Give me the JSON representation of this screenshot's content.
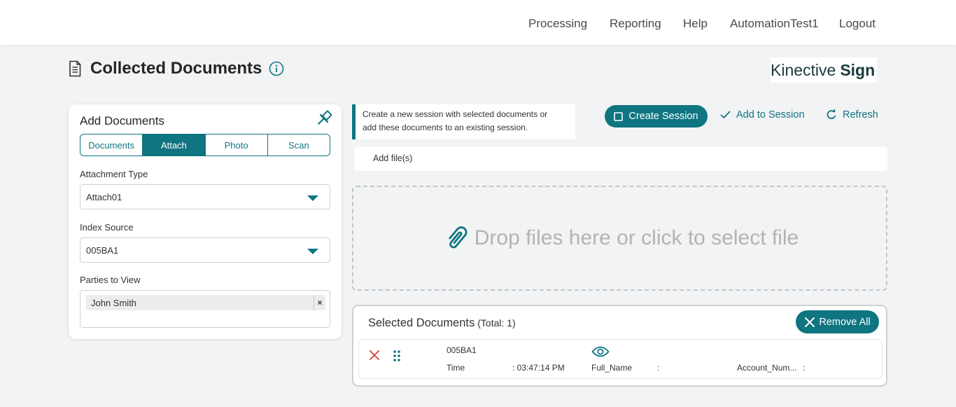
{
  "nav": {
    "processing": "Processing",
    "reporting": "Reporting",
    "help": "Help",
    "user": "AutomationTest1",
    "logout": "Logout"
  },
  "page": {
    "title": "Collected Documents"
  },
  "brand": {
    "name_light": "Kinective",
    "name_bold": "Sign"
  },
  "add_panel": {
    "title": "Add Documents",
    "tabs": [
      {
        "label": "Documents",
        "active": false
      },
      {
        "label": "Attach",
        "active": true
      },
      {
        "label": "Photo",
        "active": false
      },
      {
        "label": "Scan",
        "active": false
      }
    ],
    "attachment_type": {
      "label": "Attachment Type",
      "value": "Attach01"
    },
    "index_source": {
      "label": "Index Source",
      "value": "005BA1"
    },
    "parties": {
      "label": "Parties to View",
      "chips": [
        "John Smith"
      ],
      "remove_symbol": "×"
    }
  },
  "session": {
    "hint_line1": "Create a new session with selected documents or",
    "hint_line2": "add these documents to an existing session.",
    "create_label": "Create Session",
    "add_label": "Add to Session",
    "refresh_label": "Refresh"
  },
  "upload": {
    "add_files_label": "Add file(s)",
    "drop_text": "Drop files here or click to select file"
  },
  "selected_docs": {
    "title": "Selected Documents",
    "total": "(Total: 1)",
    "remove_all_label": "Remove All",
    "rows": [
      {
        "name": "005BA1",
        "time_label": "Time",
        "time_value": ": 03:47:14 PM",
        "full_name_label": "Full_Name",
        "full_name_value": ":",
        "account_label": "Account_Num...",
        "account_value": ":"
      }
    ]
  },
  "colors": {
    "accent": "#0f7581",
    "danger": "#d9534f",
    "background": "#f2f3f4"
  }
}
